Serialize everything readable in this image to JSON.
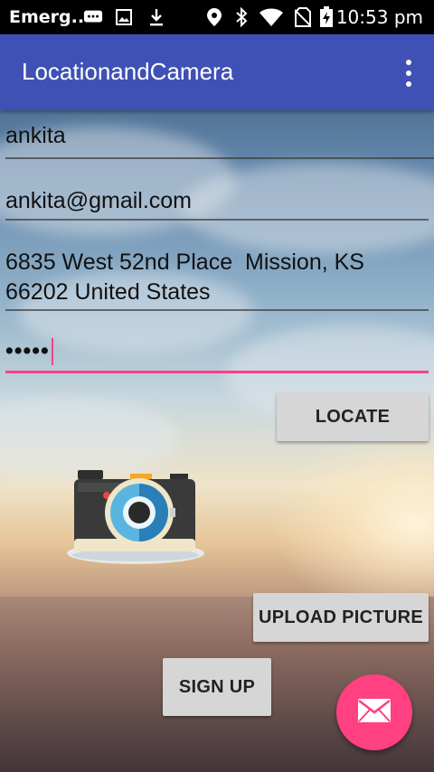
{
  "status_bar": {
    "carrier": "Emerg..",
    "time": "10:53 pm",
    "icons": [
      "message-icon",
      "image-icon",
      "download-icon",
      "location-icon",
      "bluetooth-icon",
      "wifi-icon",
      "no-sim-icon",
      "battery-charging-icon"
    ]
  },
  "app_bar": {
    "title": "LocationandCamera",
    "menu_icon": "overflow-menu-icon"
  },
  "form": {
    "name": "ankita",
    "email": "ankita@gmail.com",
    "address": "6835 West 52nd Place  Mission, KS\n66202 United States",
    "password_mask": "•••••"
  },
  "buttons": {
    "locate": "LOCATE",
    "upload": "UPLOAD PICTURE",
    "signup": "SIGN UP"
  },
  "images": {
    "camera": "camera-icon"
  },
  "fab": {
    "icon": "email-icon"
  },
  "colors": {
    "primary": "#3f51b5",
    "accent": "#ff4081",
    "button": "#d6d6d6"
  }
}
